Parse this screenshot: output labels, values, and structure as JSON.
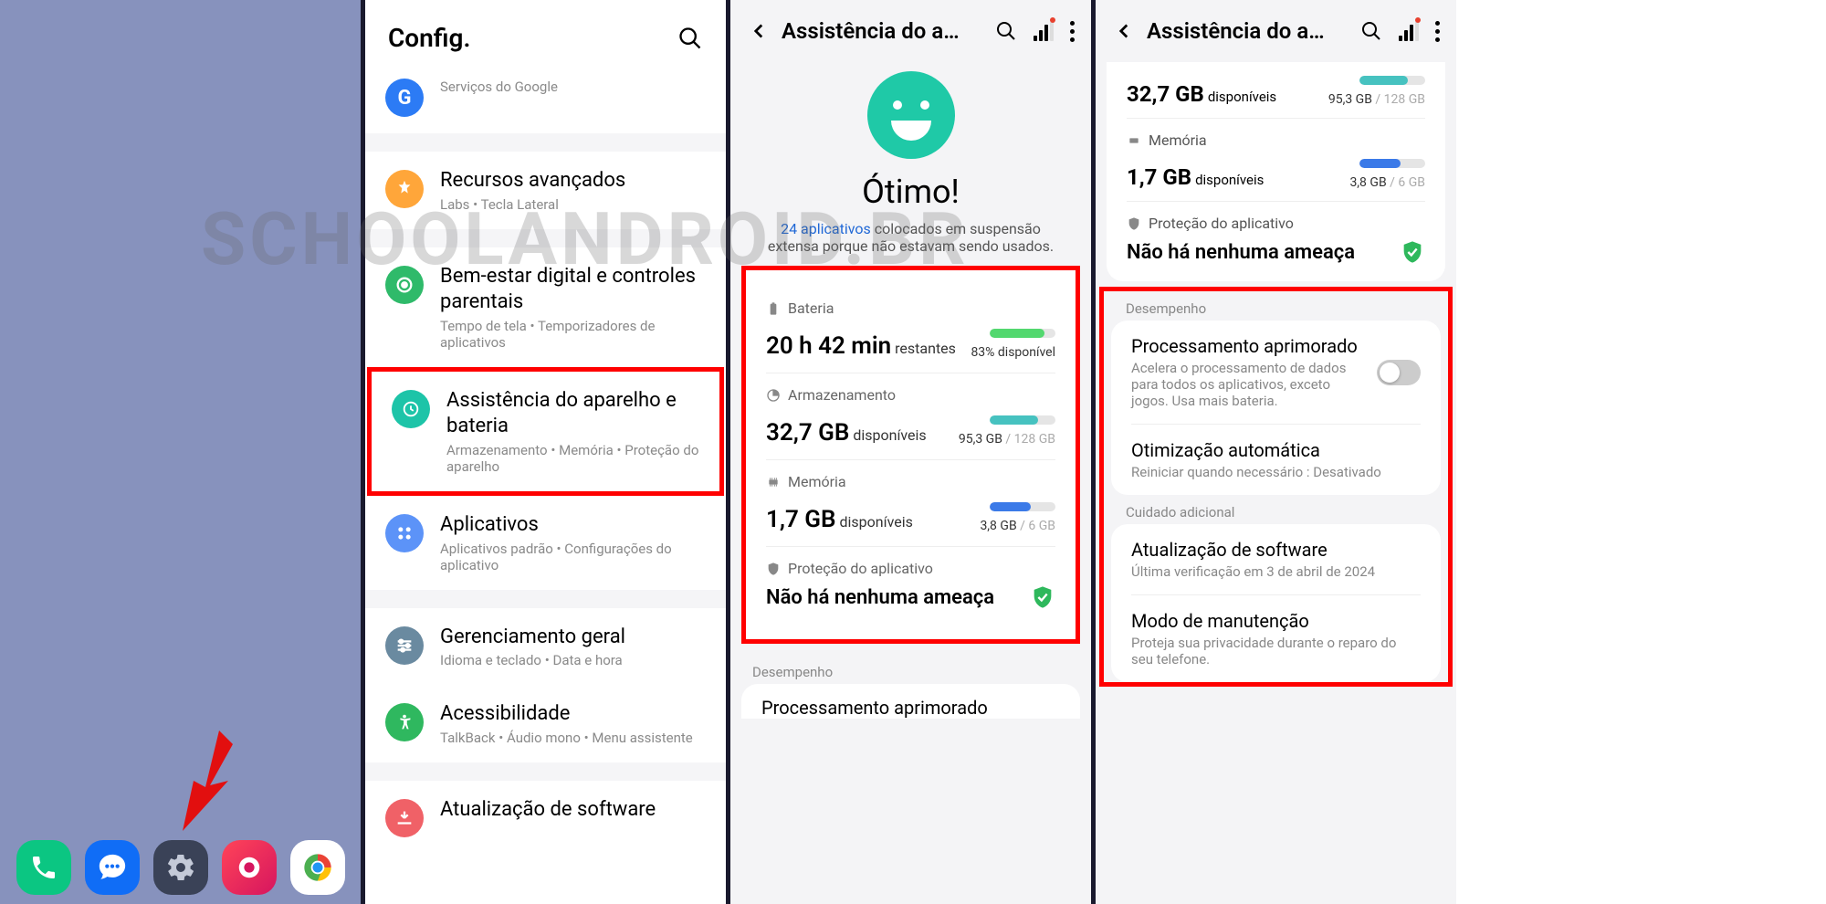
{
  "watermark": "SCHOOLANDROID.BR",
  "panel1": {
    "dock": [
      "phone",
      "messages",
      "settings",
      "camera",
      "chrome"
    ]
  },
  "panel2": {
    "title": "Config.",
    "items": [
      {
        "title": "Google",
        "sub": "Serviços do Google",
        "icon": "google",
        "partial": true
      },
      {
        "title": "Recursos avançados",
        "sub": "Labs • Tecla Lateral",
        "icon": "advanced"
      },
      {
        "title": "Bem-estar digital e controles parentais",
        "sub": "Tempo de tela • Temporizadores de aplicativos",
        "icon": "wellbeing"
      },
      {
        "title": "Assistência do aparelho e bateria",
        "sub": "Armazenamento • Memória • Proteção do aparelho",
        "icon": "devicecare",
        "highlight": true
      },
      {
        "title": "Aplicativos",
        "sub": "Aplicativos padrão • Configurações do aplicativo",
        "icon": "apps"
      },
      {
        "title": "Gerenciamento geral",
        "sub": "Idioma e teclado • Data e hora",
        "icon": "general"
      },
      {
        "title": "Acessibilidade",
        "sub": "TalkBack • Áudio mono • Menu assistente",
        "icon": "accessibility"
      },
      {
        "title": "Atualização de software",
        "sub": "",
        "icon": "update"
      }
    ]
  },
  "panel3": {
    "title": "Assistência do a…",
    "status": "Ótimo!",
    "status_sub_link": "24 aplicativos",
    "status_sub_rest": " colocados em suspensão extensa porque não estavam sendo usados.",
    "battery": {
      "label": "Bateria",
      "value": "20 h 42 min",
      "value_sub": "restantes",
      "percent_text": "83% disponível",
      "percent": 83
    },
    "storage": {
      "label": "Armazenamento",
      "value": "32,7 GB",
      "value_sub": "disponíveis",
      "used": "95,3 GB",
      "total": " / 128 GB",
      "percent": 74
    },
    "memory": {
      "label": "Memória",
      "value": "1,7 GB",
      "value_sub": "disponíveis",
      "used": "3,8 GB",
      "total": " / 6 GB",
      "percent": 63
    },
    "protection": {
      "label": "Proteção do aplicativo",
      "text": "Não há nenhuma ameaça"
    },
    "perf_label": "Desempenho",
    "perf_item": "Processamento aprimorado"
  },
  "panel4": {
    "title": "Assistência do a…",
    "storage": {
      "value": "32,7 GB",
      "value_sub": "disponíveis",
      "used": "95,3 GB",
      "total": " / 128 GB",
      "percent": 74
    },
    "memory": {
      "label": "Memória",
      "value": "1,7 GB",
      "value_sub": "disponíveis",
      "used": "3,8 GB",
      "total": " / 6 GB",
      "percent": 63
    },
    "protection": {
      "label": "Proteção do aplicativo",
      "text": "Não há nenhuma ameaça"
    },
    "perf_label": "Desempenho",
    "enhanced": {
      "title": "Processamento aprimorado",
      "sub": "Acelera o processamento de dados para todos os aplicativos, exceto jogos. Usa mais bateria."
    },
    "auto_opt": {
      "title": "Otimização automática",
      "sub": "Reiniciar quando necessário : Desativado"
    },
    "additional_label": "Cuidado adicional",
    "software": {
      "title": "Atualização de software",
      "sub": "Última verificação em 3 de abril de 2024"
    },
    "maintenance": {
      "title": "Modo de manutenção",
      "sub": "Proteja sua privacidade durante o reparo do seu telefone."
    }
  }
}
